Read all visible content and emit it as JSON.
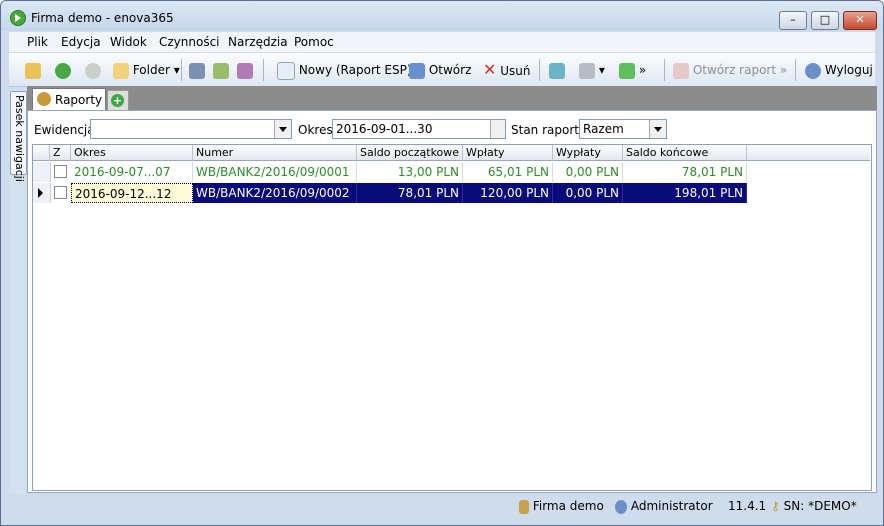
{
  "window": {
    "title": "Firma demo - enova365"
  },
  "menu": [
    "Plik",
    "Edycja",
    "Widok",
    "Czynności",
    "Narzędzia",
    "Pomoc"
  ],
  "toolbar": {
    "folder_label": "Folder",
    "new_label": "Nowy (Raport ESP)",
    "open_label": "Otwórz",
    "delete_label": "Usuń",
    "open_report_label": "Otwórz raport",
    "logout_label": "Wyloguj"
  },
  "sidebar": {
    "tab_label": "Pasek nawigacji"
  },
  "tabs": {
    "active_label": "Raporty"
  },
  "filters": {
    "evidence_label": "Ewidencja:",
    "evidence_value": "",
    "period_label": "Okres:",
    "period_value": "2016-09-01...30",
    "status_label": "Stan raportu:",
    "status_value": "Razem"
  },
  "grid": {
    "columns": [
      "Z",
      "Okres",
      "Numer",
      "Saldo początkowe",
      "Wpłaty",
      "Wypłaty",
      "Saldo końcowe"
    ],
    "rows": [
      {
        "okres": "2016-09-07...07",
        "numer": "WB/BANK2/2016/09/0001",
        "saldo_pocz": "13,00 PLN",
        "wplaty": "65,01 PLN",
        "wyplaty": "0,00 PLN",
        "saldo_konc": "78,01 PLN"
      },
      {
        "okres": "2016-09-12...12",
        "numer": "WB/BANK2/2016/09/0002",
        "saldo_pocz": "78,01 PLN",
        "wplaty": "120,00 PLN",
        "wyplaty": "0,00 PLN",
        "saldo_konc": "198,01 PLN"
      }
    ]
  },
  "status": {
    "company": "Firma demo",
    "user": "Administrator",
    "version": "11.4.1",
    "serial": "SN: *DEMO*"
  }
}
